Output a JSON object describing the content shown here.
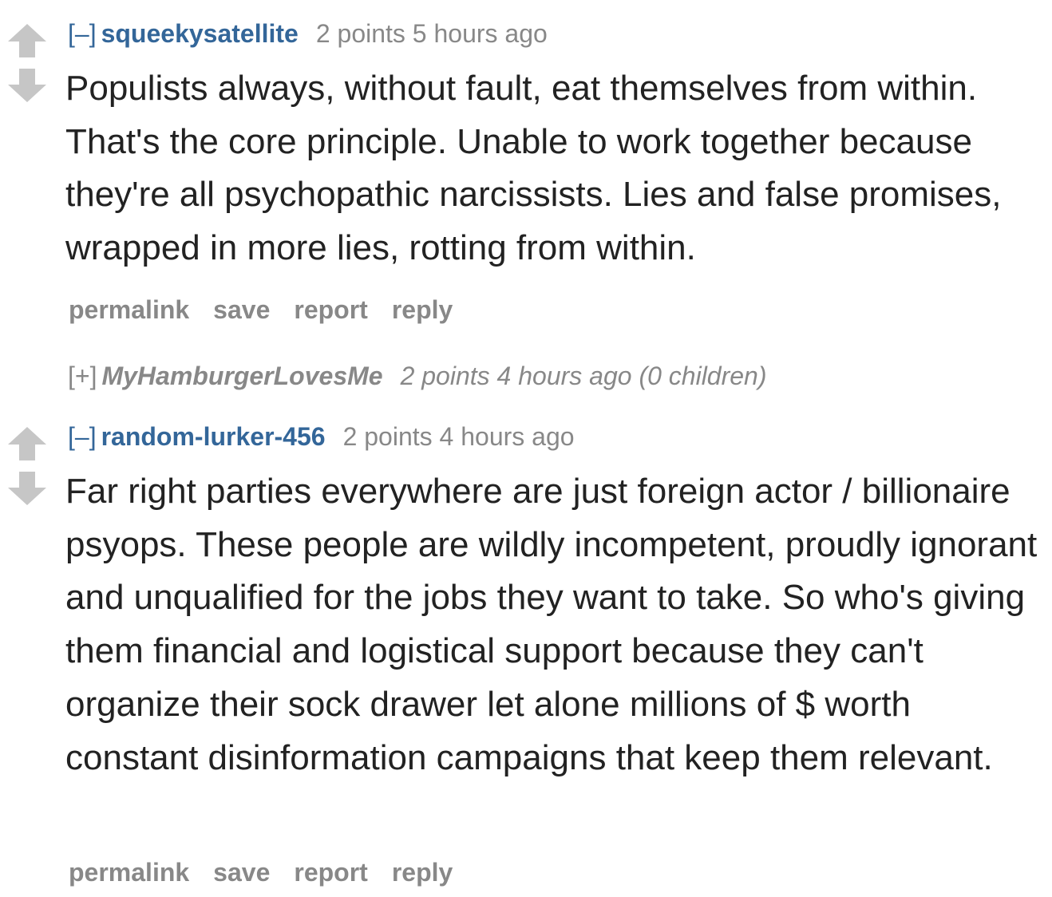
{
  "comments": [
    {
      "expand_label": "[–]",
      "author": "squeekysatellite",
      "score": "2 points",
      "time": "5 hours ago",
      "body": "Populists always, without fault, eat themselves from within. That's the core principle. Unable to work together because they're all psychopathic narcissists. Lies and false promises, wrapped in more lies, rotting from within.",
      "buttons": {
        "permalink": "permalink",
        "save": "save",
        "report": "report",
        "reply": "reply"
      }
    },
    {
      "expand_label": "[+]",
      "author": "MyHamburgerLovesMe",
      "score": "2 points",
      "time": "4 hours ago",
      "children": "(0 children)"
    },
    {
      "expand_label": "[–]",
      "author": "random-lurker-456",
      "score": "2 points",
      "time": "4 hours ago",
      "body": "Far right parties everywhere are just foreign actor / billionaire psyops. These people are wildly incompetent, proudly ignorant and unqualified for the jobs they want to take. So who's giving them financial and logistical support because they can't organize their sock drawer let alone millions of $ worth constant disinformation campaigns that keep them relevant.",
      "buttons": {
        "permalink": "permalink",
        "save": "save",
        "report": "report",
        "reply": "reply"
      }
    }
  ],
  "colors": {
    "link": "#336699",
    "muted": "#888888",
    "text": "#222222",
    "arrow": "#c6c6c6"
  },
  "icons": {
    "upvote": "upvote-arrow-icon",
    "downvote": "downvote-arrow-icon"
  }
}
